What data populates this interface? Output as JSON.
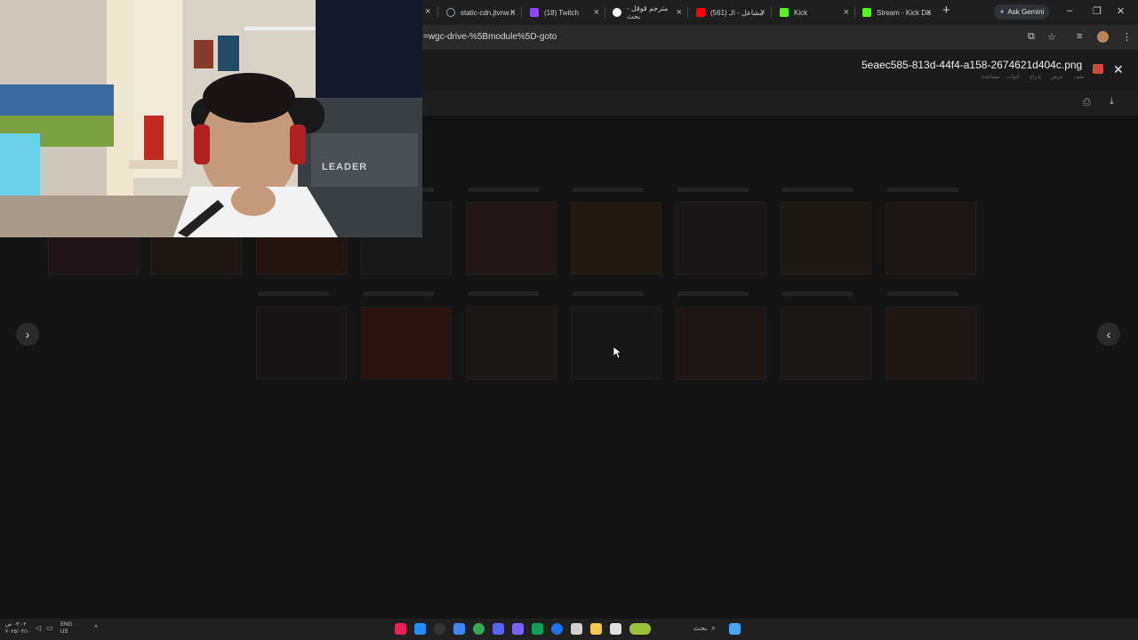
{
  "browser": {
    "tabs": [
      {
        "label": "static-cdn.jtvnw.n",
        "color": "#9aa0a6"
      },
      {
        "label": "(18) Twitch",
        "color": "#9146ff"
      },
      {
        "label": "مترجم قوقل - بحث",
        "color": "#4285f4"
      },
      {
        "label": "(561) مشاعل - الـ",
        "color": "#ff0000"
      },
      {
        "label": "Kick",
        "color": "#53fc18"
      },
      {
        "label": "Stream - Kick Da",
        "color": "#53fc18"
      }
    ],
    "new_tab": "+",
    "gemini_label": "Ask Gemini",
    "url": "=wgc-drive-%5Bmodule%5D-goto"
  },
  "viewer": {
    "filename": "5eaec585-813d-44f4-a158-2674621d404c.png",
    "menu": [
      "ملف",
      "عرض",
      "إدراج",
      "أدوات",
      "مساعدة"
    ],
    "close_glyph": "✕",
    "prev_glyph": "‹",
    "next_glyph": "›"
  },
  "taskbar": {
    "clock_time": "٠٣:٠٢ ص",
    "clock_date": "٢٠٢٥/٠٣/١٠",
    "lang_top": "ENG",
    "lang_bottom": "US",
    "search_label": "بحث",
    "icons": [
      "#ee1d52",
      "#1e90ff",
      "#333",
      "#4285f4",
      "#34a853",
      "#5865f2",
      "#7b61ff",
      "#0f9d58",
      "#d0d0d0",
      "#f2c94c",
      "#e0e0e0",
      "#9bbf3a"
    ]
  }
}
